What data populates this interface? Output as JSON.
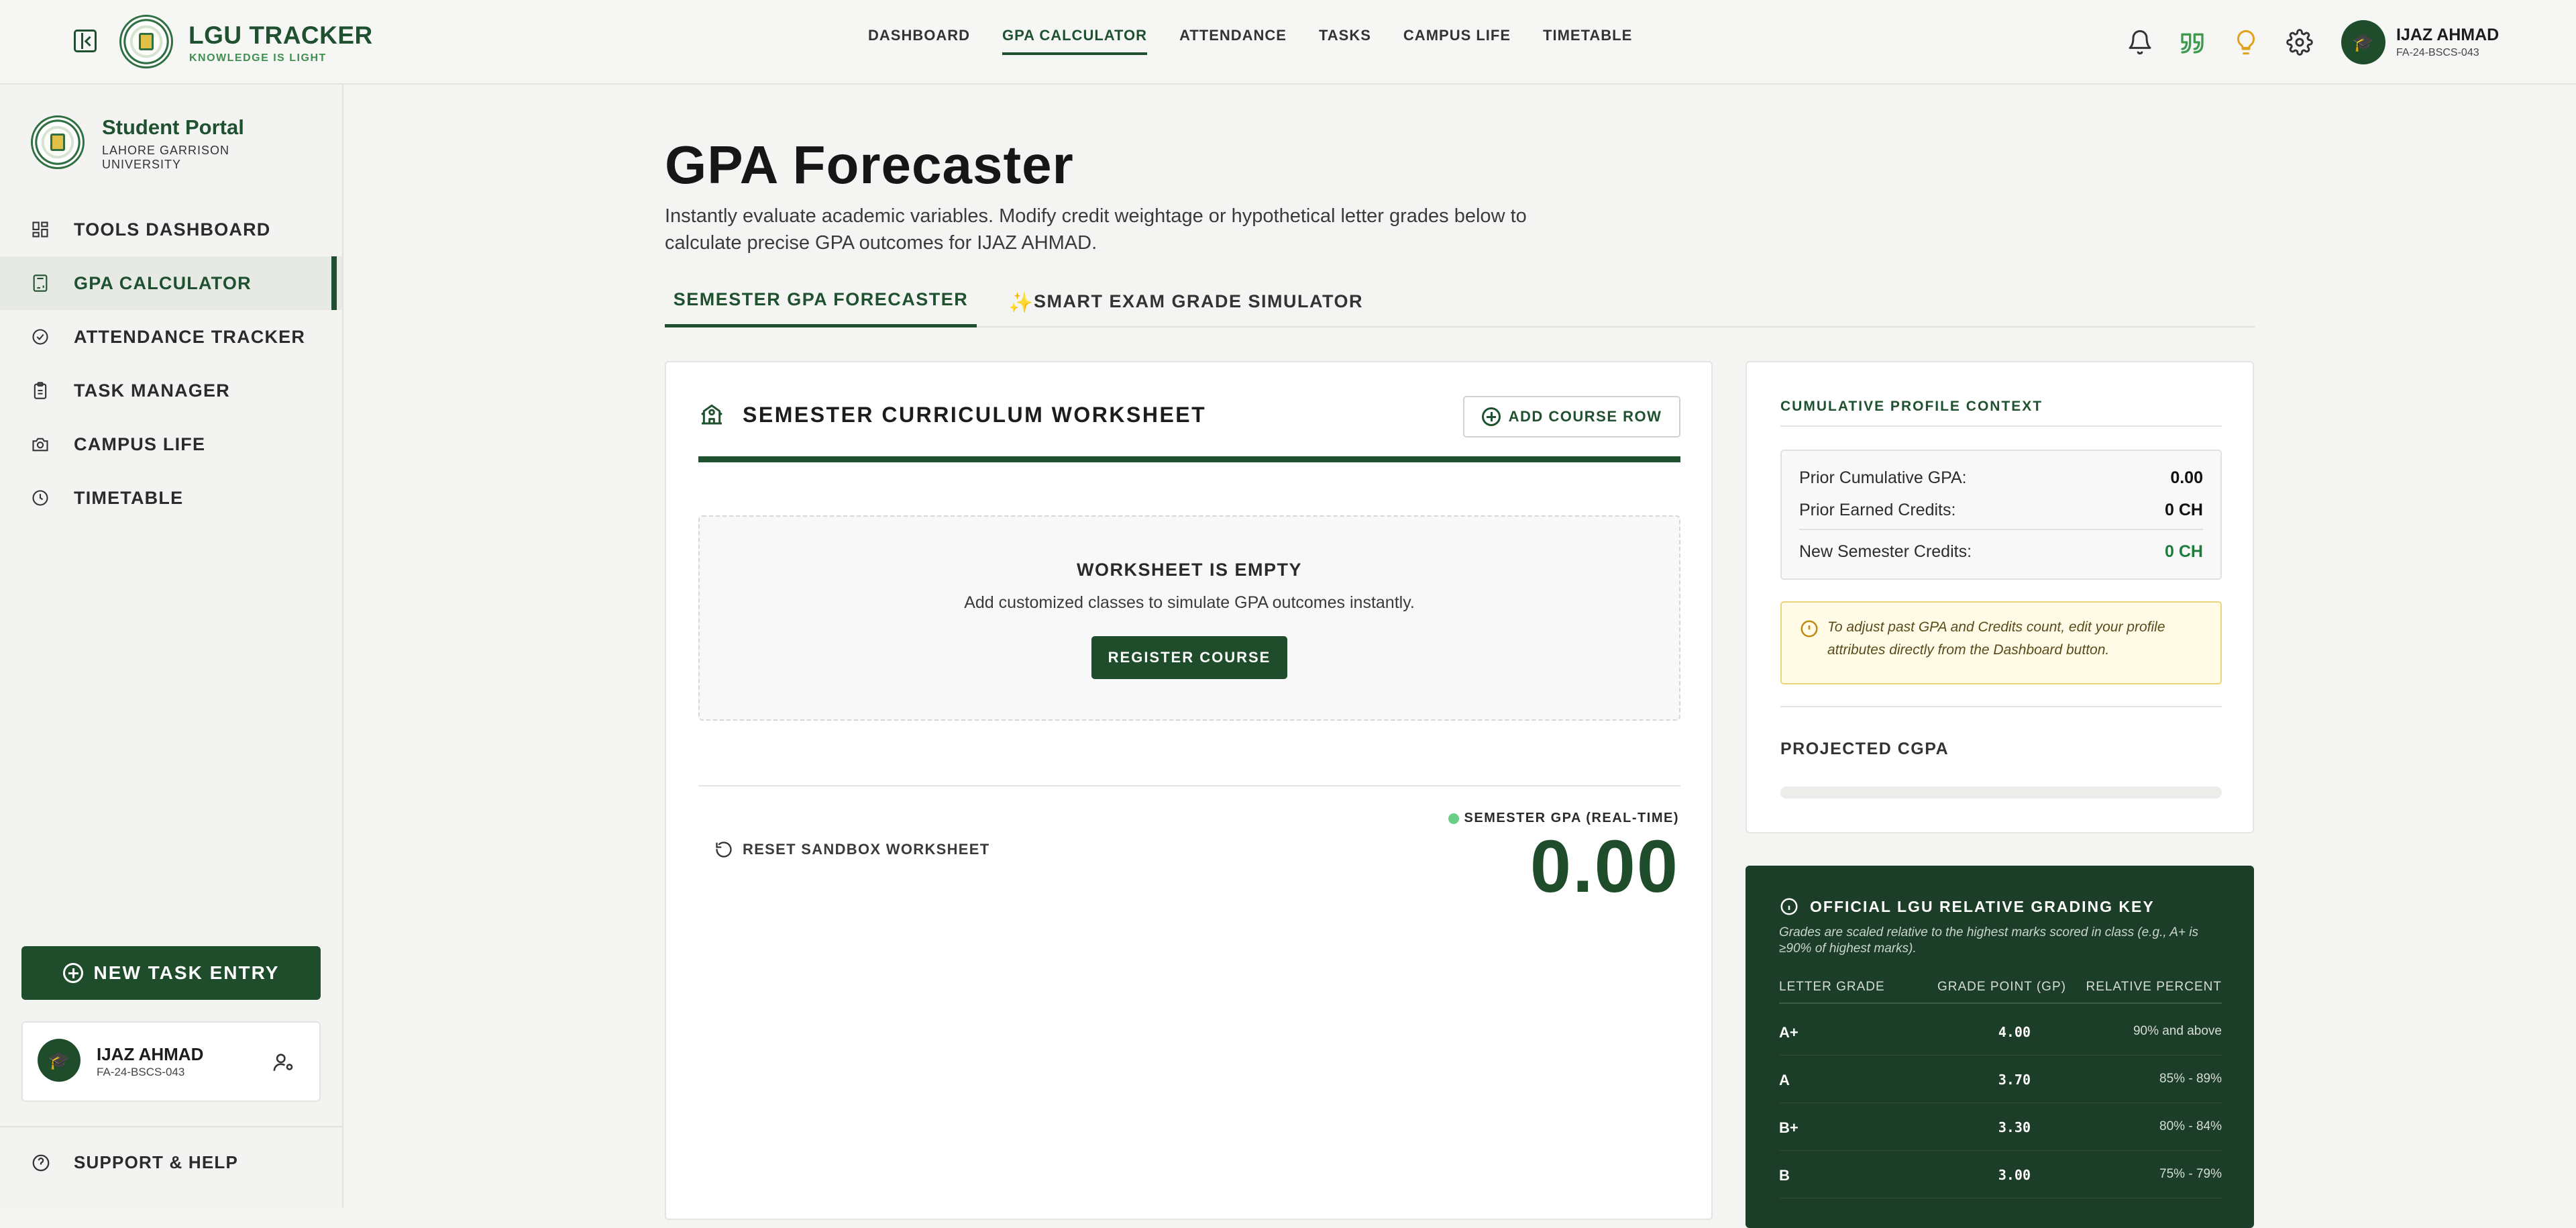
{
  "brand": {
    "title": "LGU TRACKER",
    "tagline": "KNOWLEDGE IS LIGHT"
  },
  "topnav": {
    "items": [
      "DASHBOARD",
      "GPA CALCULATOR",
      "ATTENDANCE",
      "TASKS",
      "CAMPUS LIFE",
      "TIMETABLE"
    ],
    "active": "GPA CALCULATOR"
  },
  "user": {
    "name": "IJAZ AHMAD",
    "id": "FA-24-BSCS-043"
  },
  "sidebar": {
    "portal_title": "Student Portal",
    "university": "LAHORE GARRISON UNIVERSITY",
    "items": [
      {
        "label": "TOOLS DASHBOARD",
        "icon": "grid-icon"
      },
      {
        "label": "GPA CALCULATOR",
        "icon": "calculator-icon"
      },
      {
        "label": "ATTENDANCE TRACKER",
        "icon": "check-circle-icon"
      },
      {
        "label": "TASK MANAGER",
        "icon": "clipboard-icon"
      },
      {
        "label": "CAMPUS LIFE",
        "icon": "camera-icon"
      },
      {
        "label": "TIMETABLE",
        "icon": "clock-icon"
      }
    ],
    "active": "GPA CALCULATOR",
    "new_task_label": "NEW TASK ENTRY",
    "support_label": "SUPPORT & HELP"
  },
  "page": {
    "title": "GPA Forecaster",
    "description": "Instantly evaluate academic variables. Modify credit weightage or hypothetical letter grades below to calculate precise GPA outcomes for IJAZ AHMAD.",
    "tabs": [
      "SEMESTER GPA FORECASTER",
      "SMART EXAM GRADE SIMULATOR"
    ],
    "active_tab": "SEMESTER GPA FORECASTER"
  },
  "worksheet": {
    "title": "SEMESTER CURRICULUM WORKSHEET",
    "add_row_label": "ADD COURSE ROW",
    "empty_title": "WORKSHEET IS EMPTY",
    "empty_sub": "Add customized classes to simulate GPA outcomes instantly.",
    "register_label": "REGISTER COURSE",
    "reset_label": "RESET SANDBOX WORKSHEET",
    "gpa_label": "SEMESTER GPA (REAL-TIME)",
    "gpa_value": "0.00"
  },
  "profile": {
    "title": "CUMULATIVE PROFILE CONTEXT",
    "prior_gpa_label": "Prior Cumulative GPA:",
    "prior_gpa_value": "0.00",
    "prior_credits_label": "Prior Earned Credits:",
    "prior_credits_value": "0 CH",
    "new_credits_label": "New Semester Credits:",
    "new_credits_value": "0 CH",
    "note": "To adjust past GPA and Credits count, edit your profile attributes directly from the Dashboard button.",
    "projected_label": "PROJECTED CGPA",
    "projected_progress": 0
  },
  "grading": {
    "title": "OFFICIAL LGU RELATIVE GRADING KEY",
    "subtitle": "Grades are scaled relative to the highest marks scored in class (e.g., A+ is ≥90% of highest marks).",
    "headers": [
      "LETTER GRADE",
      "GRADE POINT (GP)",
      "RELATIVE PERCENT"
    ],
    "rows": [
      {
        "grade": "A+",
        "gp": "4.00",
        "range": "90% and above"
      },
      {
        "grade": "A",
        "gp": "3.70",
        "range": "85% - 89%"
      },
      {
        "grade": "B+",
        "gp": "3.30",
        "range": "80% - 84%"
      },
      {
        "grade": "B",
        "gp": "3.00",
        "range": "75% - 79%"
      }
    ]
  },
  "colors": {
    "primary": "#1f5130",
    "dark_card": "#1c3d27",
    "accent_gold": "#d6a72a",
    "live_dot": "#69cf87"
  }
}
